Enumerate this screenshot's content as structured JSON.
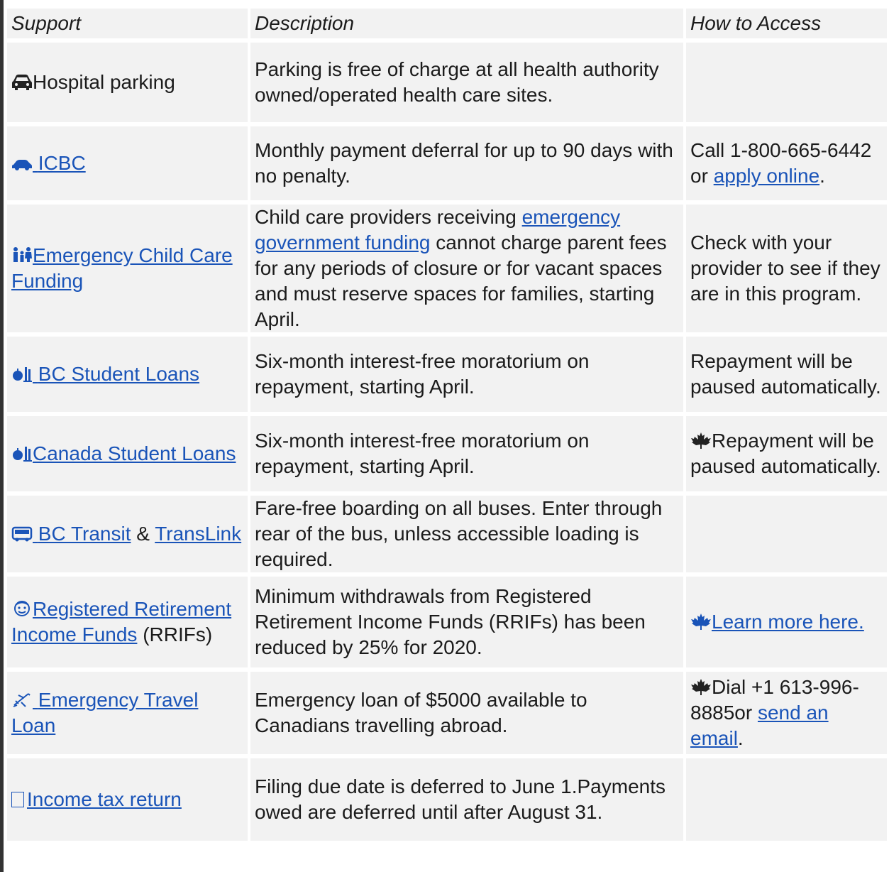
{
  "header": {
    "support": "Support",
    "description": "Description",
    "how_to_access": "How to Access"
  },
  "rows": [
    {
      "support": "Hospital parking",
      "support_icon": "car-icon",
      "description": "Parking is free of charge at all health authority owned/operated health care sites.",
      "access": ""
    },
    {
      "support": "ICBC",
      "support_icon": "car-icon",
      "description": "Monthly payment deferral for up to 90 days with no penalty.",
      "access_pre": "Call 1-800-665-6442 or ",
      "access_link": "apply online",
      "access_post": "."
    },
    {
      "support": "Emergency Child Care Funding",
      "support_icon": "family-icon",
      "description_pre": "Child care providers receiving ",
      "description_link": "emergency government funding",
      "description_post": " cannot charge parent fees for any periods of closure or for vacant spaces and must reserve spaces for families, starting April.",
      "access": "Check with your provider to see if they are in this program."
    },
    {
      "support": "BC Student Loans",
      "support_icon": "apple-books-icon",
      "description": "Six-month interest-free moratorium on repayment, starting April.",
      "access": "Repayment will be paused automatically."
    },
    {
      "support": "Canada Student Loans",
      "support_icon": "apple-books-icon",
      "description": "Six-month interest-free moratorium on repayment, starting April.",
      "access": "Repayment will be paused automatically.",
      "access_icon": "maple-leaf-icon"
    },
    {
      "support_link_1": "BC Transit",
      "support_sep": " & ",
      "support_link_2": "TransLink",
      "support_icon": "bus-icon",
      "description": "Fare-free boarding on all buses. Enter through rear of the bus, unless accessible loading is required.",
      "access": ""
    },
    {
      "support_link": "Registered Retirement Income Funds",
      "support_post": " (RRIFs)",
      "support_icon": "elder-face-icon",
      "description": "Minimum withdrawals from Registered Retirement Income Funds (RRIFs) has been reduced by 25% for 2020.",
      "access_link": "Learn more here.",
      "access_icon": "maple-leaf-icon"
    },
    {
      "support": "Emergency Travel Loan",
      "support_icon": "airplane-icon",
      "description": "Emergency loan of $5000 available to Canadians travelling abroad.",
      "access_pre": "Dial +1 613-996-8885or ",
      "access_link": "send an email",
      "access_post": ".",
      "access_icon": "maple-leaf-icon"
    },
    {
      "support": "Income tax return",
      "support_icon": "box-icon",
      "description": "Filing due date is deferred to June 1.Payments owed are deferred until after August 31.",
      "access": ""
    }
  ],
  "colors": {
    "link": "#1a54b8",
    "cell_bg": "#f2f2f2",
    "text": "#1b1b1b"
  }
}
